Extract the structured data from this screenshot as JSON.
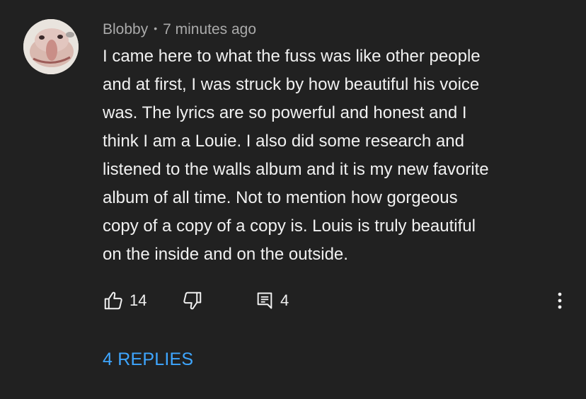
{
  "comment": {
    "author": "Blobby",
    "separator": "•",
    "time": "7 minutes ago",
    "lines": [
      "I came here to what the fuss was like other people",
      "and at first, I was struck by how beautiful his voice",
      "was. The lyrics are so powerful and honest and I",
      "think I am a Louie. I also did some research and",
      "listened to the walls album and it is my new favorite",
      "album of all time. Not to mention how gorgeous",
      "copy of a copy of a copy is. Louis is truly beautiful",
      "on the inside and on the outside."
    ],
    "likes": "14",
    "reply_count": "4",
    "replies_label": "4 REPLIES"
  },
  "icons": {
    "like": "thumbs-up-icon",
    "dislike": "thumbs-down-icon",
    "reply": "comment-icon",
    "more": "more-vertical-icon"
  },
  "colors": {
    "background": "#212121",
    "text": "#f1f1f1",
    "meta": "#aaaaaa",
    "link": "#3ea6ff"
  }
}
